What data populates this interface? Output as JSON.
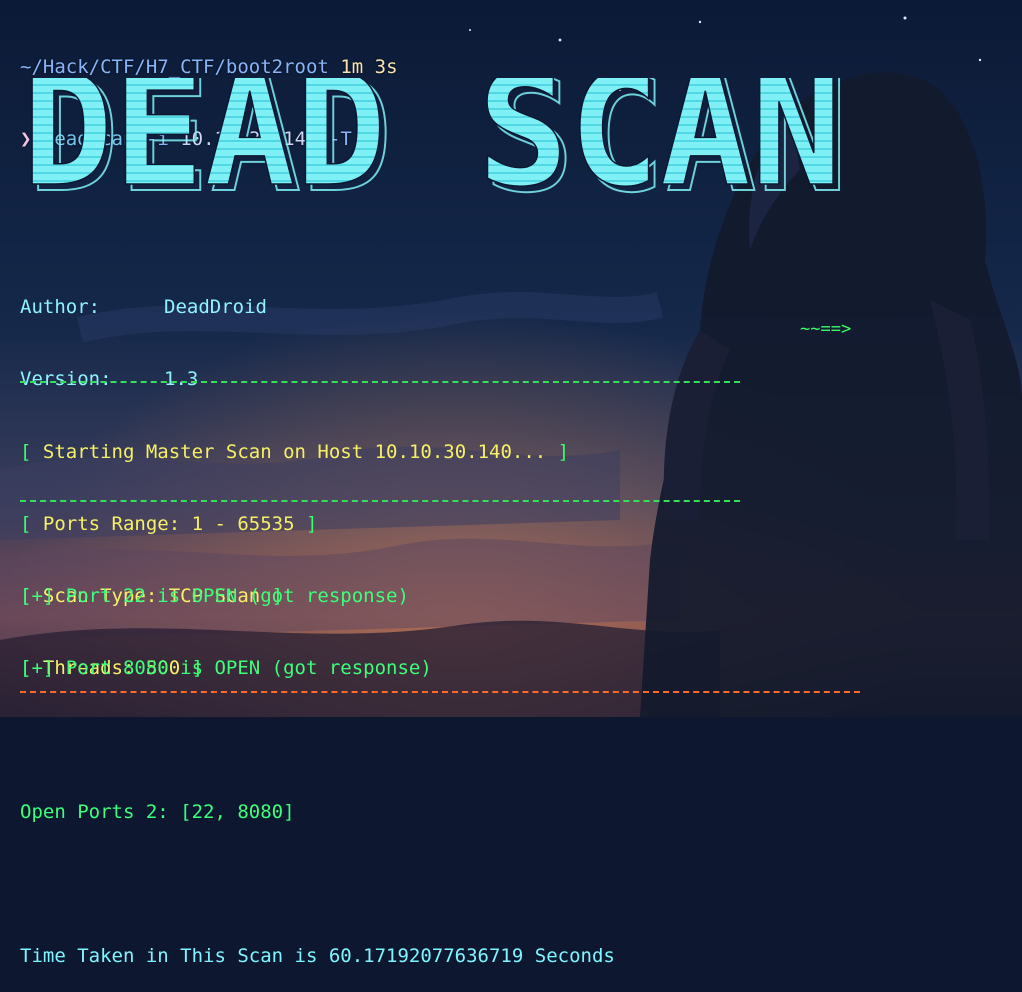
{
  "prompt": {
    "path": "~/Hack/CTF/H7_CTF/boot2root",
    "duration": "1m 3s",
    "arrow": "❯",
    "command": "deadscan",
    "flag_i": "-i",
    "ip": "10.10.30.140",
    "flag_t": "-T"
  },
  "banner": {
    "text": "DEAD SCAN"
  },
  "meta": {
    "author_label": "Author:",
    "author": "DeadDroid",
    "version_label": "Version:",
    "version": "1.3",
    "decoration": "~~==>"
  },
  "scan": {
    "lbr": "[",
    "rbr": "]",
    "starting": " Starting Master Scan on Host 10.10.30.140... ",
    "ports_range": " Ports Range: 1 - 65535 ",
    "scan_type": " Scan Type: TCP Scan ",
    "threads": " Threads: 500 "
  },
  "results": {
    "marker": "[+]",
    "port1": " Port 22 is OPEN (got response)",
    "port2": " Port 8080 is OPEN (got response)",
    "open_ports": "Open Ports 2: [22, 8080]",
    "time_taken": "Time Taken in This Scan is 60.17192077636719 Seconds"
  },
  "colors": {
    "banner": "#7ff0f6",
    "divider": "#34e05a",
    "divider_bottom": "#ff6a2a",
    "brackets": "#39ff6a",
    "scan_text": "#f7f066"
  }
}
